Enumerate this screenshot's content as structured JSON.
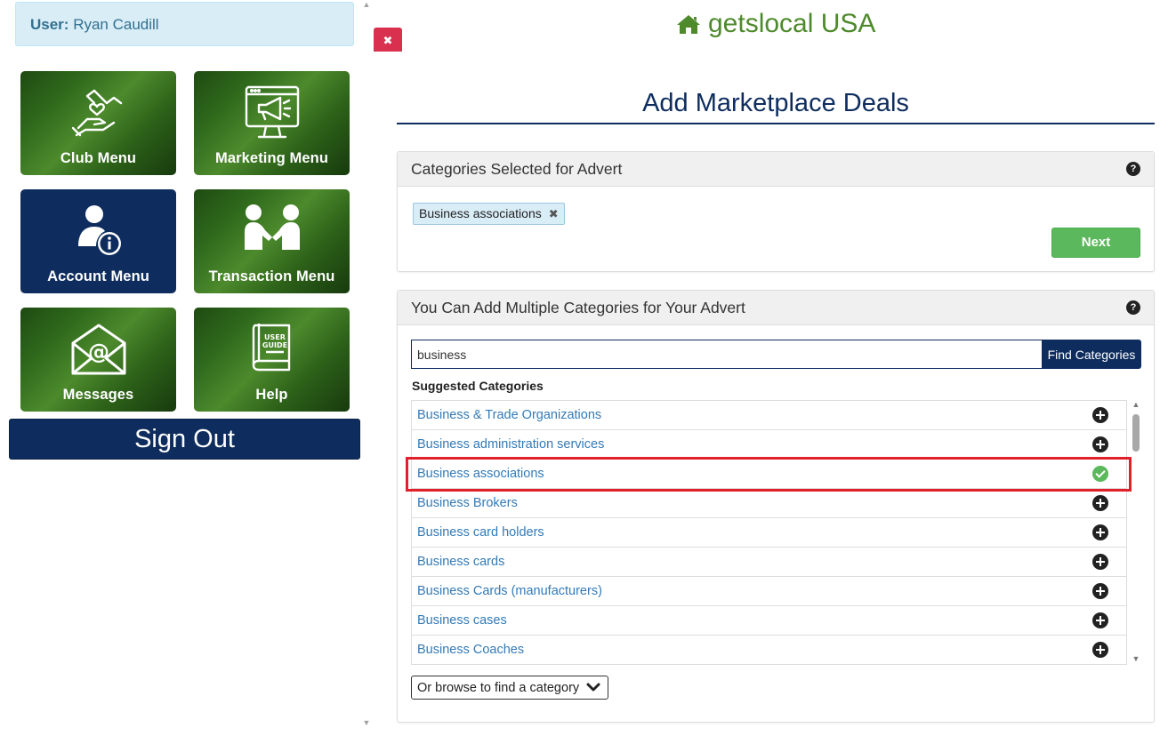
{
  "sidebar": {
    "user_label": "User:",
    "user_name": "Ryan Caudill",
    "tiles": [
      {
        "label": "Club Menu",
        "icon": "hands-heart-icon"
      },
      {
        "label": "Marketing Menu",
        "icon": "megaphone-monitor-icon"
      },
      {
        "label": "Account Menu",
        "icon": "user-info-icon"
      },
      {
        "label": "Transaction Menu",
        "icon": "handshake-icon"
      },
      {
        "label": "Messages",
        "icon": "envelope-at-icon"
      },
      {
        "label": "Help",
        "icon": "user-guide-book-icon"
      }
    ],
    "user_guide_text_1": "USER",
    "user_guide_text_2": "GUIDE",
    "sign_out": "Sign Out"
  },
  "close_button": "✖",
  "brand": {
    "icon": "home-icon",
    "name": "getslocal USA"
  },
  "page_title": "Add Marketplace Deals",
  "selected_panel": {
    "heading": "Categories Selected for Advert",
    "tags": [
      "Business associations"
    ],
    "tag_remove": "✖",
    "next_label": "Next"
  },
  "add_panel": {
    "heading": "You Can Add Multiple Categories for Your Advert",
    "search_value": "business",
    "find_label": "Find Categories",
    "suggested_label": "Suggested Categories",
    "items": [
      {
        "label": "Business & Trade Organizations",
        "selected": false
      },
      {
        "label": "Business administration services",
        "selected": false
      },
      {
        "label": "Business associations",
        "selected": true
      },
      {
        "label": "Business Brokers",
        "selected": false
      },
      {
        "label": "Business card holders",
        "selected": false
      },
      {
        "label": "Business cards",
        "selected": false
      },
      {
        "label": "Business Cards (manufacturers)",
        "selected": false
      },
      {
        "label": "Business cases",
        "selected": false
      },
      {
        "label": "Business Coaches",
        "selected": false
      }
    ],
    "browse_label": "Or browse to find a category"
  },
  "colors": {
    "navy": "#0e2d5e",
    "green_brand": "#4e8a2c",
    "success": "#5cb85c",
    "link": "#337ab7",
    "highlight": "#e0202a",
    "close_red": "#d9304f"
  }
}
